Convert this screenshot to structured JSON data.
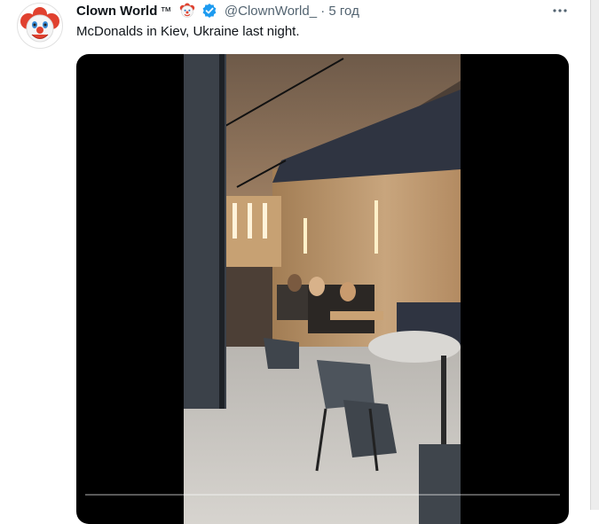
{
  "tweet": {
    "author_name": "Clown World",
    "author_suffix": "™",
    "author_emoji": "clown-face-icon",
    "verified": true,
    "handle": "@ClownWorld_",
    "separator": "·",
    "time": "5 год",
    "text": "McDonalds in Kiev, Ukraine last night.",
    "more_icon": "more-horizontal-icon"
  },
  "video": {
    "progress": 0.0,
    "content": "restaurant-interior-video-frame"
  },
  "colors": {
    "verified": "#1d9bf0",
    "text": "#0f1419",
    "secondary": "#536471",
    "media_bg": "#000000"
  }
}
